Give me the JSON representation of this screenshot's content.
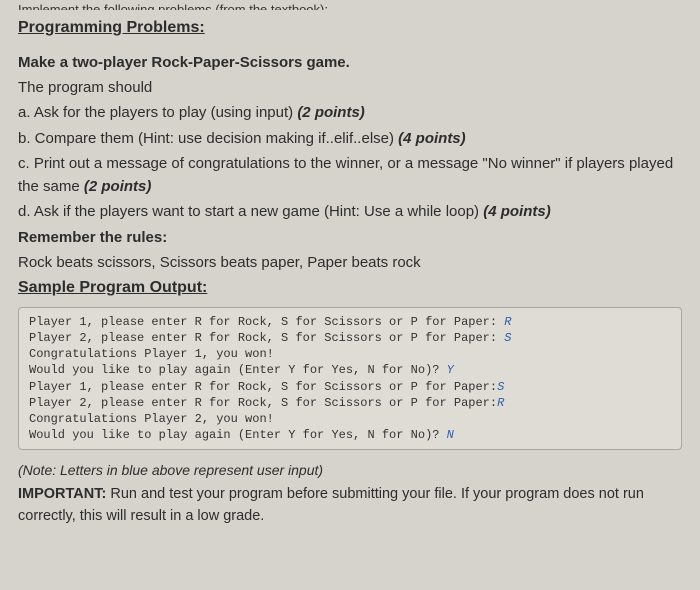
{
  "truncated_header": "Implement the following problems (from the textbook):",
  "section_title": "Programming Problems:",
  "title_line": "Make a two-player Rock-Paper-Scissors game.",
  "intro": "The program should",
  "items": {
    "a_text": "a. Ask for the players to play (using input) ",
    "a_pts": "(2 points)",
    "b_text": "b. Compare them (Hint: use decision making if..elif..else) ",
    "b_pts": "(4 points)",
    "c_text": "c. Print out a message of congratulations to the winner, or a message \"No winner\" if players played the same ",
    "c_pts": "(2 points)",
    "d_text": "d. Ask if the players want to start a new game (Hint: Use a while loop) ",
    "d_pts": "(4 points)"
  },
  "rules_header": "Remember the rules:",
  "rules_line": "Rock beats scissors, Scissors beats paper, Paper beats rock",
  "sample_header": "Sample Program Output:",
  "code": {
    "l1a": "Player 1, please enter R for Rock, S for Scissors or P for Paper: ",
    "l1b": "R",
    "l2a": "Player 2, please enter R for Rock, S for Scissors or P for Paper: ",
    "l2b": "S",
    "l3": "Congratulations Player 1, you won!",
    "l4a": "Would you like to play again (Enter Y for Yes, N for No)? ",
    "l4b": "Y",
    "l5a": "Player 1, please enter R for Rock, S for Scissors or P for Paper:",
    "l5b": "S",
    "l6a": "Player 2, please enter R for Rock, S for Scissors or P for Paper:",
    "l6b": "R",
    "l7": "Congratulations Player 2, you won!",
    "l8a": "Would you like to play again (Enter Y for Yes, N for No)? ",
    "l8b": "N"
  },
  "note": "(Note: Letters in blue above represent user input)",
  "important_label": "IMPORTANT:",
  "important_text": "  Run and test your program before submitting your file. If your program does not run correctly, this will result in a low grade."
}
